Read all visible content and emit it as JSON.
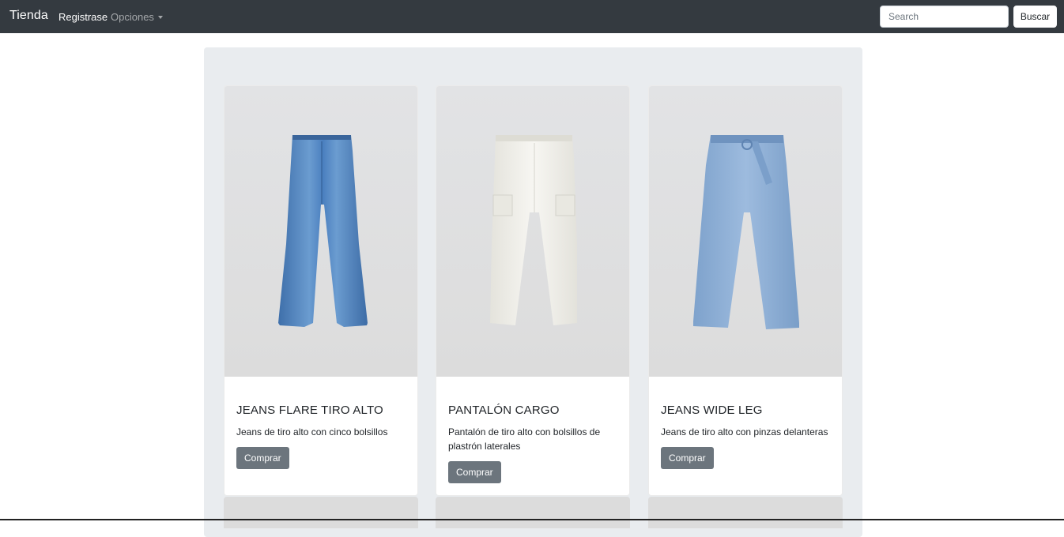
{
  "navbar": {
    "brand": "Tienda",
    "register_label": "Registrase",
    "options_label": "Opciones",
    "search_placeholder": "Search",
    "search_button": "Buscar"
  },
  "products": [
    {
      "title": "JEANS FLARE TIRO ALTO",
      "description": "Jeans de tiro alto con cinco bolsillos",
      "button": "Comprar",
      "image": "flare-jeans-image",
      "color": "#4a7fbf"
    },
    {
      "title": "PANTALÓN CARGO",
      "description": "Pantalón de tiro alto con bolsillos de plastrón laterales",
      "button": "Comprar",
      "image": "white-cargo-pants-image",
      "color": "#f2f1ec"
    },
    {
      "title": "JEANS WIDE LEG",
      "description": "Jeans de tiro alto con pinzas delanteras",
      "button": "Comprar",
      "image": "wide-leg-jeans-image",
      "color": "#86a9d2"
    }
  ],
  "colors": {
    "navbar_bg": "#343a40",
    "container_bg": "#e9ecef",
    "button_bg": "#6c757d"
  }
}
